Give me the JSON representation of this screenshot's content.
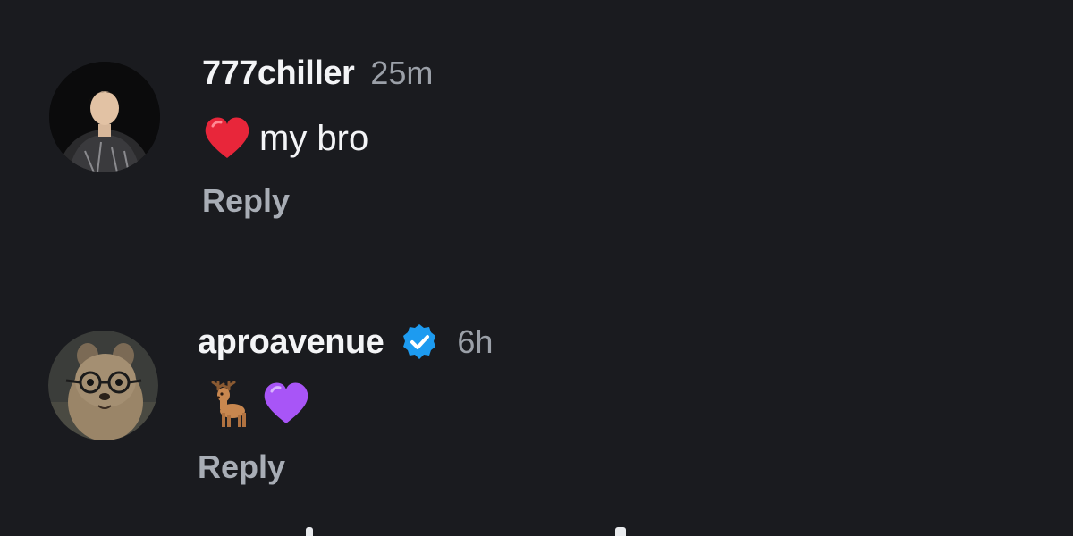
{
  "comments": [
    {
      "username": "777chiller",
      "verified": false,
      "timestamp": "25m",
      "text": "my bro",
      "emojis": [
        "red-heart"
      ],
      "reply_label": "Reply"
    },
    {
      "username": "aproavenue",
      "verified": true,
      "timestamp": "6h",
      "text": "",
      "emojis": [
        "deer",
        "purple-heart"
      ],
      "reply_label": "Reply"
    }
  ],
  "colors": {
    "background": "#1a1b1f",
    "username": "#f3f4f6",
    "timestamp": "#9ba0a8",
    "reply": "#a8adb5",
    "verified_badge": "#1d9bf0",
    "red_heart": "#e8263a",
    "purple_heart": "#a855f7"
  }
}
